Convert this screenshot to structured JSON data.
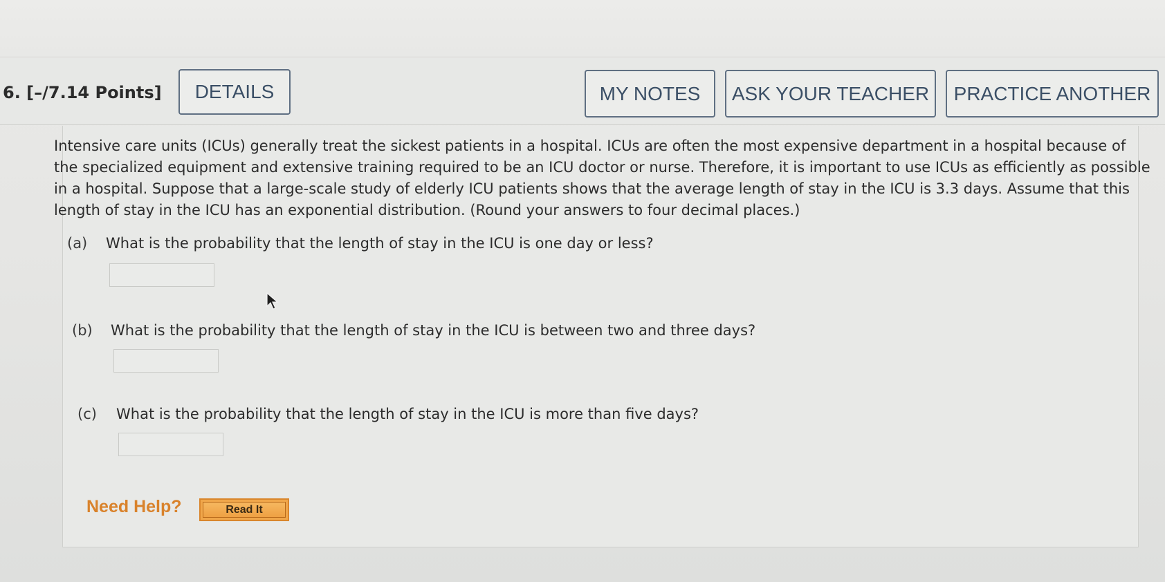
{
  "question": {
    "title": "6.  [–/7.14 Points]",
    "buttons": {
      "details": "DETAILS",
      "my_notes": "MY NOTES",
      "ask_teacher": "ASK YOUR TEACHER",
      "practice_another": "PRACTICE ANOTHER"
    },
    "prompt": "Intensive care units (ICUs) generally treat the sickest patients in a hospital. ICUs are often the most expensive department in a hospital because of the specialized equipment and extensive training required to be an ICU doctor or nurse. Therefore, it is important to use ICUs as efficiently as possible in a hospital. Suppose that a large-scale study of elderly ICU patients shows that the average length of stay in the ICU is 3.3 days. Assume that this length of stay in the ICU has an exponential distribution. (Round your answers to four decimal places.)",
    "parts": [
      {
        "letter": "(a)",
        "text": "What is the probability that the length of stay in the ICU is one day or less?",
        "answer": ""
      },
      {
        "letter": "(b)",
        "text": "What is the probability that the length of stay in the ICU is between two and three days?",
        "answer": ""
      },
      {
        "letter": "(c)",
        "text": "What is the probability that the length of stay in the ICU is more than five days?",
        "answer": ""
      }
    ],
    "help": {
      "label": "Need Help?",
      "read_it": "Read It"
    }
  },
  "colors": {
    "button_border": "#5f6f82",
    "button_text": "#3b4f66",
    "help_orange": "#d9822b",
    "read_it_fill": "#f0a64a"
  }
}
